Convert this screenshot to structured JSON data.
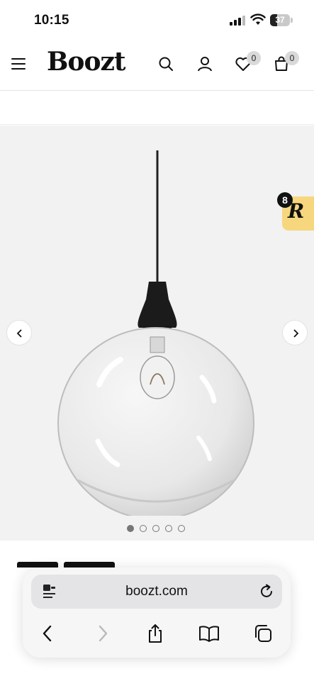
{
  "status_bar": {
    "time": "10:15",
    "battery_level": "37",
    "battery_percent": 37
  },
  "header": {
    "brand": "Boozt",
    "wishlist_count": "0",
    "cart_count": "0",
    "icons": [
      "menu-icon",
      "search-icon",
      "account-icon",
      "heart-icon",
      "bag-icon"
    ]
  },
  "gallery": {
    "image": "glass-globe-pendant-lamp",
    "slide_count": 5,
    "active_slide": 1,
    "reward_widget": {
      "badge_count": "8",
      "mark": "R"
    }
  },
  "browser": {
    "url": "boozt.com",
    "icons": [
      "page-menu-icon",
      "reload-icon",
      "back-icon",
      "forward-icon",
      "share-icon",
      "bookmarks-icon",
      "tabs-icon"
    ]
  },
  "colors": {
    "gallery_bg": "#f2f2f2",
    "reward_bg": "#f6d77d",
    "text": "#111111"
  }
}
